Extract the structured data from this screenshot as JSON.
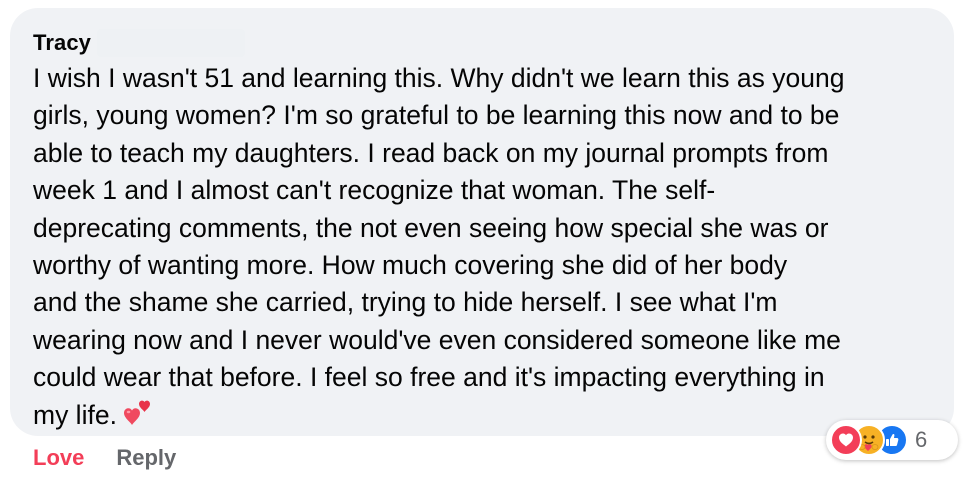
{
  "comment": {
    "author": "Tracy",
    "text_lines": [
      "I wish I wasn't 51 and learning this. Why didn't we learn this as young",
      "girls, young women? I'm so grateful to be learning this now and to be",
      "able to teach my daughters. I read back on my journal prompts from",
      "week 1 and I almost can't recognize that woman. The self-",
      "deprecating comments, the not even seeing how special she was or",
      "worthy of wanting more. How much covering she did of her body",
      "and the shame she carried, trying to hide herself. I see what I'm",
      "wearing now and I never would've even considered someone like me",
      "could wear that before. I feel so free and it's impacting everything in",
      "my life."
    ],
    "trailing_emoji": "two-hearts-icon"
  },
  "reactions": {
    "icons": [
      "heart-react-icon",
      "care-react-icon",
      "like-react-icon"
    ],
    "count": "6"
  },
  "actions": {
    "love_label": "Love",
    "reply_label": "Reply"
  },
  "colors": {
    "bubble": "#f0f2f5",
    "love": "#f33e58",
    "care": "#f7b125",
    "like": "#1877f2",
    "muted": "#65676b",
    "text": "#050505"
  }
}
